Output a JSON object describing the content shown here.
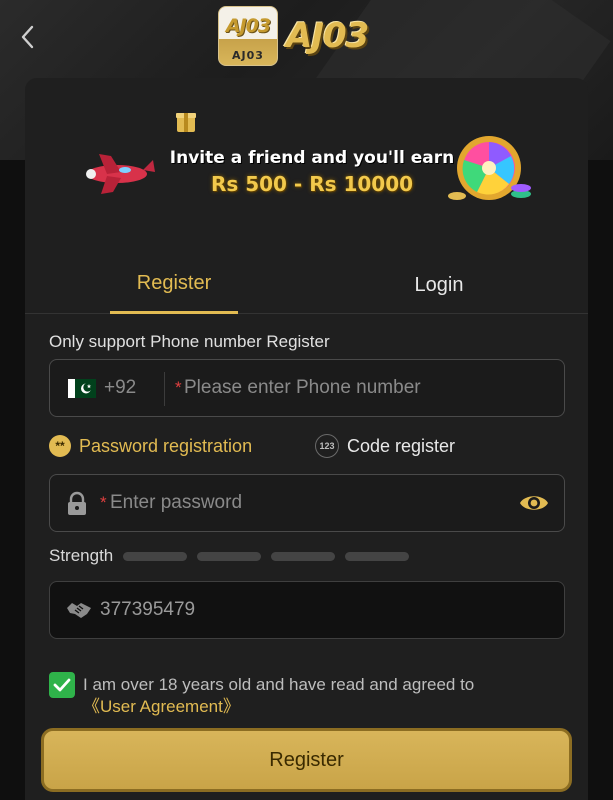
{
  "header": {
    "logo_square_top": "AJ03",
    "logo_square_bottom": "AJ03",
    "logo_text": "AJ03"
  },
  "banner": {
    "line1": "Invite a friend and you'll earn",
    "line2": "Rs 500 - Rs 10000"
  },
  "tabs": [
    {
      "label": "Register",
      "active": true
    },
    {
      "label": "Login",
      "active": false
    }
  ],
  "form": {
    "support_note": "Only support Phone number Register",
    "country_code": "+92",
    "phone_placeholder": "Please enter Phone number",
    "required_mark": "*",
    "modes": [
      {
        "label": "Password registration",
        "badge": "**",
        "active": true
      },
      {
        "label": "Code register",
        "badge": "123",
        "active": false
      }
    ],
    "password_placeholder": "Enter password",
    "strength_label": "Strength",
    "captcha_value": "377395479",
    "agree_text": "I am over 18 years old and have read and agreed to",
    "agree_link": "《User Agreement》",
    "agree_checked": true,
    "submit_label": "Register"
  },
  "colors": {
    "accent": "#e2bb52",
    "background": "#1f1f1f",
    "check_green": "#2fb34a",
    "required_red": "#e04040"
  },
  "icons": [
    "chevron-left-icon",
    "pakistan-flag-icon",
    "lock-icon",
    "eye-icon",
    "handshake-icon",
    "check-icon"
  ]
}
